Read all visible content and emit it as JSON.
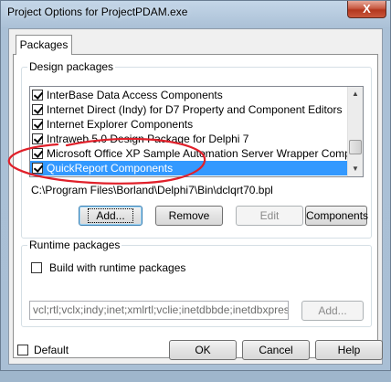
{
  "window": {
    "title": "Project Options for ProjectPDAM.exe",
    "close_glyph": "X"
  },
  "tabs": [
    {
      "label": "Packages"
    }
  ],
  "design_packages": {
    "label": "Design packages",
    "items": [
      {
        "label": "InterBase Data Access Components",
        "checked": true
      },
      {
        "label": "Internet Direct (Indy) for D7 Property and Component Editors",
        "checked": true
      },
      {
        "label": "Internet Explorer Components",
        "checked": true
      },
      {
        "label": "Intraweb 5.0 Design Package for Delphi 7",
        "checked": true
      },
      {
        "label": "Microsoft Office XP Sample Automation Server Wrapper Components",
        "checked": true
      },
      {
        "label": "QuickReport Components",
        "checked": true,
        "selected": true
      }
    ],
    "selected_path": "C:\\Program Files\\Borland\\Delphi7\\Bin\\dclqrt70.bpl",
    "buttons": {
      "add": "Add...",
      "remove": "Remove",
      "edit": "Edit",
      "components": "Components"
    }
  },
  "runtime_packages": {
    "label": "Runtime packages",
    "build_with_runtime_label": "Build with runtime packages",
    "build_with_runtime_checked": false,
    "packages_value": "vcl;rtl;vclx;indy;inet;xmlrtl;vclie;inetdbbde;inetdbxpress;dbrtl;c",
    "add_button": "Add..."
  },
  "footer": {
    "default_label": "Default",
    "default_checked": false,
    "ok": "OK",
    "cancel": "Cancel",
    "help": "Help"
  },
  "colors": {
    "selection": "#3399ff",
    "annotation": "#e0202a"
  }
}
